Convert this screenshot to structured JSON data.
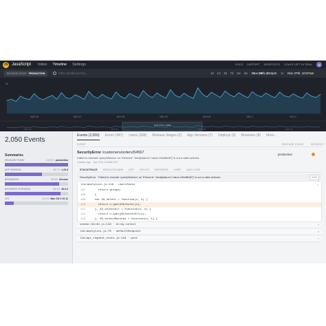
{
  "nav": {
    "logo_glyph": "JS",
    "project": "JavaScript",
    "links": [
      "Inbox",
      "Timeline",
      "Settings"
    ],
    "right_links": [
      "DOCS",
      "SUPPORT",
      "SHORTCUTS",
      "3 DAYS LEFT IN TRIAL"
    ],
    "avatar_initial": "JE"
  },
  "filter": {
    "stage_label": "RELEASE STAGE",
    "stage_value": "PRODUCTION",
    "search_placeholder": "Filter dashboard by...",
    "ranges": [
      "1h",
      "1d",
      "3d",
      "7d",
      "2w",
      "3w",
      "1m",
      "3m",
      "6m"
    ],
    "date_from": "Nov 26th, 3:12pm",
    "date_to_word": "to",
    "date_to": "Nov 27th, 10:57am"
  },
  "chart_data": {
    "type": "area",
    "title": "",
    "top_tick_label": "2k",
    "x_ticks": [
      "NOV 26",
      "NOV 27",
      "NOV 28",
      "NOV 29",
      "NOV 30",
      "DEC 1",
      "DEC 2"
    ],
    "overview_ticks": [
      "NOV 26",
      "NOV 27",
      "NOV 28",
      "NOV 29"
    ],
    "range_label": "NOV 27TH, 12PM",
    "values": [
      820,
      900,
      760,
      1100,
      950,
      880,
      1250,
      980,
      870,
      1020,
      1150,
      900,
      1320,
      1000,
      940,
      1180,
      1060,
      890,
      1400,
      1100,
      970,
      1210,
      1030,
      920,
      1360,
      1080,
      950,
      1260,
      1120,
      990,
      1450,
      1160,
      1000,
      1300,
      1110,
      980,
      1500,
      1150,
      1020,
      1280,
      1090,
      960,
      1620,
      1230,
      1040,
      1340,
      1170,
      1010,
      1420,
      1190,
      1050,
      1310,
      1140,
      990,
      1380,
      1160,
      1060,
      1290,
      1120,
      1000,
      1350,
      1130,
      1030,
      1240,
      1080,
      970,
      1300,
      1100,
      1010,
      1220
    ],
    "ylim": [
      0,
      2000
    ],
    "grid": false
  },
  "left": {
    "events_count": "2,050 Events",
    "summaries_title": "Summaries",
    "rows": [
      {
        "label": "RELEASE STAGE",
        "pct": "100.0%",
        "value": "production",
        "fill": 1.0,
        "color": "#7d69c9"
      },
      {
        "label": "APP VERSION",
        "pct": "58.7%",
        "value": "1.20.8",
        "fill": 0.587,
        "color": "#7d69c9"
      },
      {
        "label": "BROWSERS",
        "pct": "85.8%",
        "value": "Chrome",
        "fill": 0.858,
        "color": "#7d69c9"
      },
      {
        "label": "BROWSER VERSIONS",
        "pct": "88.5%",
        "value": "45.0.0",
        "fill": 0.885,
        "color": "#7d69c9"
      },
      {
        "label": "O/S",
        "pct": "14.3%",
        "value": "Mac OS X 10.11",
        "fill": 0.143,
        "color": "#7d69c9"
      }
    ]
  },
  "main": {
    "tabs": [
      "Events (2,050)",
      "Errors (447)",
      "Users (268)",
      "Release Stages (2)",
      "App Versions (7)",
      "Deploys (3)",
      "Browsers (8)",
      "More..."
    ],
    "event_col": "EVENT",
    "stage_col": "RELEASE STAGE",
    "severity_col": "SEVERITY",
    "error_class": "SecurityError",
    "error_context": "/customers/orders/54567",
    "error_message": "Failed to execute 'querySelector' on 'Element': '#ect[data-id=\"value-24bdf6d5\"]' is not a valid selector.",
    "meta": [
      "2 weeks ago",
      "Nov 27th, 2:00AM UTC"
    ],
    "release_stage": "production",
    "stack_tabs": [
      "STACKTRACE",
      "BREADCRUMBS",
      "APP",
      "DEVICE",
      "BROWSER",
      "USER",
      "ADD A TAB"
    ],
    "stack_summary": "SecurityError · Failed to execute 'querySelector' on 'Element': '#ect[data-id=\"value-24bdf6d5\"]' is not a valid selector.",
    "raw_label": "RAW",
    "frame1_file": "lib/analytics.js:118 · usersState",
    "code": [
      {
        "ln": "107",
        "text": "    return groups;"
      },
      {
        "ln": "108",
        "text": "  }"
      },
      {
        "ln": "109",
        "text": "  var d3_select = function(s, n) {"
      },
      {
        "ln": "110",
        "text": "    return n.querySelector(s);"
      },
      {
        "ln": "111",
        "text": "  }, d3_selectAll = function(s, n) {"
      },
      {
        "ln": "112",
        "text": "    return n.querySelectorAll(s);"
      },
      {
        "ln": "113",
        "text": "  }, d3_selectMatches = function(n, s) {"
      }
    ],
    "frames": [
      "vendor/d3/d3.js:118 · Array.select",
      "lib/analytics.js:76 · defaultEndpoint",
      "lib/api_request_stats.js:118 · post"
    ],
    "arrow_glyph": "↗"
  }
}
